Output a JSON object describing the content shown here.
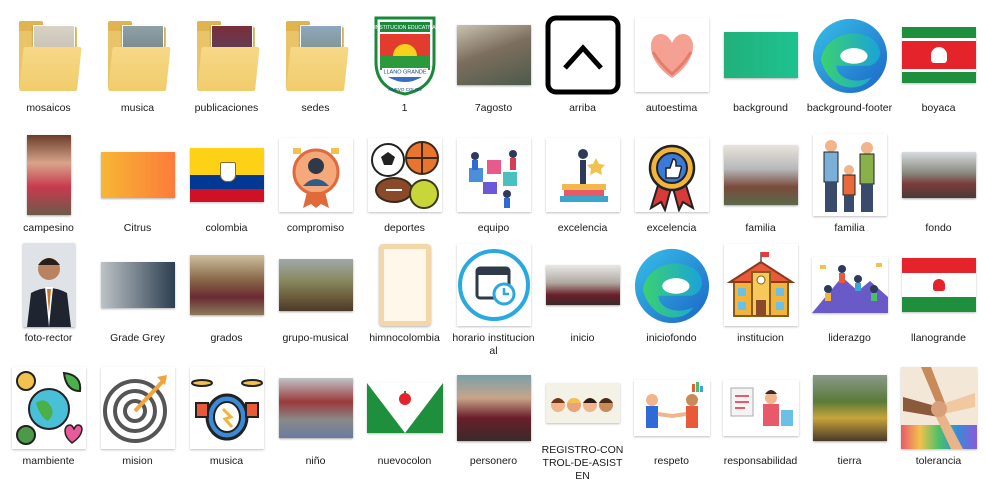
{
  "items": [
    {
      "label": "mosaicos",
      "icon": "folder-icon"
    },
    {
      "label": "musica",
      "icon": "folder-icon"
    },
    {
      "label": "publicaciones",
      "icon": "folder-icon"
    },
    {
      "label": "sedes",
      "icon": "folder-icon"
    },
    {
      "label": "1",
      "icon": "school-crest-icon",
      "crest_text": {
        "top": "INSTITUCION EDUCATIVA",
        "middle": "LLANO GRANDE",
        "bottom": "NUEVO COLON"
      }
    },
    {
      "label": "7agosto",
      "icon": "group-photo-image"
    },
    {
      "label": "arriba",
      "icon": "chevron-up-icon"
    },
    {
      "label": "autoestima",
      "icon": "heart-hands-icon"
    },
    {
      "label": "background",
      "icon": "gradient-image"
    },
    {
      "label": "background-footer",
      "icon": "edge-logo-icon"
    },
    {
      "label": "boyaca",
      "icon": "boyaca-flag-image"
    },
    {
      "label": "campesino",
      "icon": "children-photo-image"
    },
    {
      "label": "Citrus",
      "icon": "citrus-gradient-image"
    },
    {
      "label": "colombia",
      "icon": "colombia-flag-image"
    },
    {
      "label": "compromiso",
      "icon": "award-person-icon"
    },
    {
      "label": "deportes",
      "icon": "sports-balls-icon"
    },
    {
      "label": "equipo",
      "icon": "puzzle-team-icon"
    },
    {
      "label": "excelencia",
      "icon": "books-trophy-icon"
    },
    {
      "label": "excelencia",
      "icon": "medal-thumb-icon"
    },
    {
      "label": "familia",
      "icon": "school-photo-image"
    },
    {
      "label": "familia",
      "icon": "family-icon"
    },
    {
      "label": "fondo",
      "icon": "crowd-photo-image"
    },
    {
      "label": "foto-rector",
      "icon": "portrait-photo-image"
    },
    {
      "label": "Grade Grey",
      "icon": "grey-gradient-image"
    },
    {
      "label": "grados",
      "icon": "graduation-photo-image"
    },
    {
      "label": "grupo-musical",
      "icon": "band-photo-image"
    },
    {
      "label": "himnocolombia",
      "icon": "parchment-image"
    },
    {
      "label": "horario institucional",
      "icon": "calendar-clock-icon"
    },
    {
      "label": "inicio",
      "icon": "students-photo-image"
    },
    {
      "label": "iniciofondo",
      "icon": "edge-logo-icon"
    },
    {
      "label": "institucion",
      "icon": "school-building-icon"
    },
    {
      "label": "liderazgo",
      "icon": "leadership-icon"
    },
    {
      "label": "llanogrande",
      "icon": "llanogrande-flag-image"
    },
    {
      "label": "mambiente",
      "icon": "environment-icon"
    },
    {
      "label": "mision",
      "icon": "target-icon"
    },
    {
      "label": "musica",
      "icon": "drums-icon"
    },
    {
      "label": "niño",
      "icon": "hallway-photo-image"
    },
    {
      "label": "nuevocolon",
      "icon": "nuevocolon-flag-image"
    },
    {
      "label": "personero",
      "icon": "personero-photo-image"
    },
    {
      "label": "REGISTRO-CONTROL-DE-ASISTEN",
      "icon": "kids-faces-icon"
    },
    {
      "label": "respeto",
      "icon": "handshake-icon"
    },
    {
      "label": "responsabilidad",
      "icon": "responsibility-icon"
    },
    {
      "label": "tierra",
      "icon": "garden-photo-image"
    },
    {
      "label": "tolerancia",
      "icon": "hands-together-icon"
    }
  ]
}
